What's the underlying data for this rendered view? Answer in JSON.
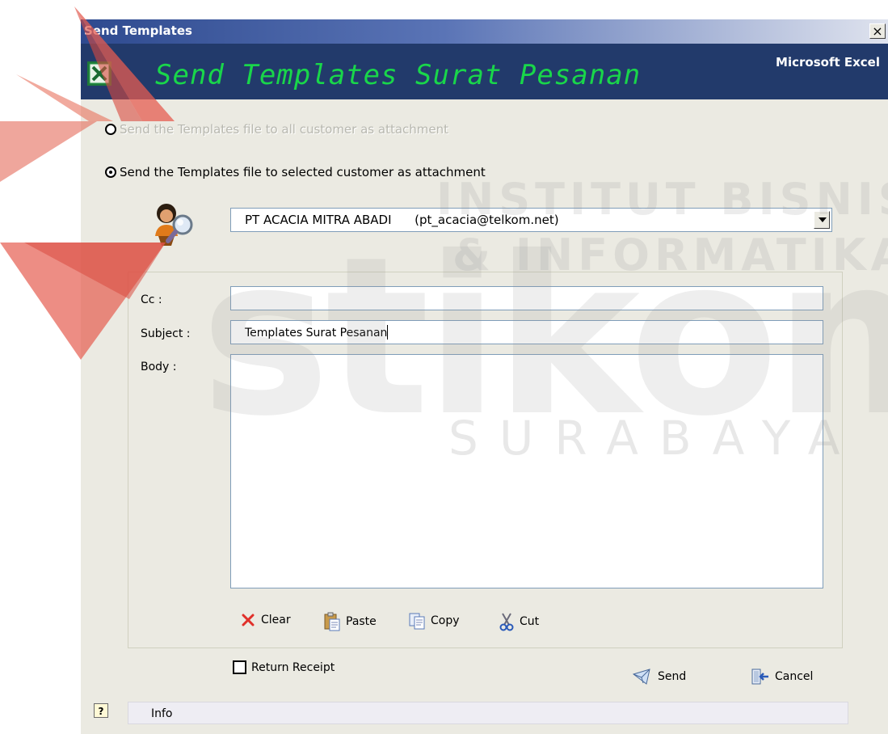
{
  "window": {
    "title": "Send Templates",
    "close_glyph": "×"
  },
  "banner": {
    "title": "Send Templates Surat Pesanan",
    "app_name": "Microsoft Excel",
    "title_color": "#19d64a",
    "background_color": "#223a6b"
  },
  "options": {
    "all_customers_label": "Send the Templates file to all customer as attachment",
    "all_customers_checked": false,
    "all_customers_enabled": false,
    "selected_customer_label": "Send the Templates file to selected customer as attachment",
    "selected_customer_checked": true
  },
  "customer": {
    "selected_value": "PT ACACIA MITRA ABADI      (pt_acacia@telkom.net)"
  },
  "form": {
    "cc_label": "Cc :",
    "cc_value": "",
    "subject_label": "Subject :",
    "subject_value": "Templates Surat Pesanan",
    "body_label": "Body :",
    "body_value": ""
  },
  "toolbar": {
    "clear_label": "Clear",
    "paste_label": "Paste",
    "copy_label": "Copy",
    "cut_label": "Cut"
  },
  "return_receipt": {
    "label": "Return Receipt",
    "checked": false
  },
  "actions": {
    "send_label": "Send",
    "cancel_label": "Cancel"
  },
  "status": {
    "text": "Info"
  },
  "watermark": {
    "line1": "INSTITUT BISNIS",
    "line2": "& INFORMATIKA",
    "big": "stikom",
    "city": "SURABAYA"
  },
  "icons": {
    "close": "close-icon",
    "excel": "excel-logo-icon",
    "customer": "customer-search-icon",
    "clear": "clear-x-icon",
    "paste": "paste-icon",
    "copy": "copy-icon",
    "cut": "scissors-icon",
    "send": "send-mail-icon",
    "cancel": "exit-door-icon",
    "help": "help-icon"
  }
}
